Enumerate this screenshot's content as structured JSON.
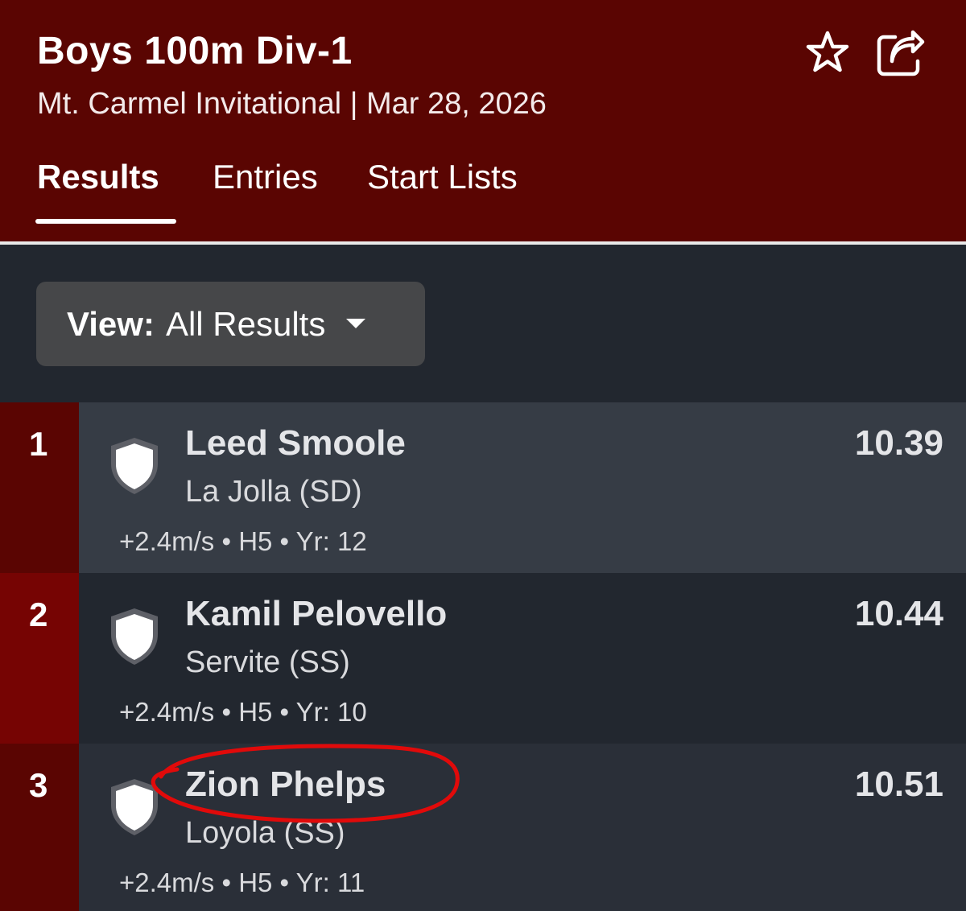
{
  "header": {
    "title": "Boys 100m Div-1",
    "subtitle": "Mt. Carmel Invitational | Mar 28, 2026",
    "favorite_icon": "star-outline-icon",
    "share_icon": "share-icon",
    "colors": {
      "header_bg": "#5a0502",
      "page_bg": "#22272f"
    }
  },
  "tabs": [
    {
      "label": "Results",
      "active": true
    },
    {
      "label": "Entries",
      "active": false
    },
    {
      "label": "Start Lists",
      "active": false
    }
  ],
  "view": {
    "label": "View:",
    "value": "All Results"
  },
  "results": [
    {
      "rank": "1",
      "name": "Leed Smoole",
      "school": "La Jolla (SD)",
      "mark": "10.39",
      "meta": "+2.4m/s • H5 • Yr: 12"
    },
    {
      "rank": "2",
      "name": "Kamil Pelovello",
      "school": "Servite (SS)",
      "mark": "10.44",
      "meta": "+2.4m/s • H5 • Yr: 10"
    },
    {
      "rank": "3",
      "name": "Zion Phelps",
      "school": "Loyola (SS)",
      "mark": "10.51",
      "meta": "+2.4m/s • H5 • Yr: 11"
    }
  ]
}
